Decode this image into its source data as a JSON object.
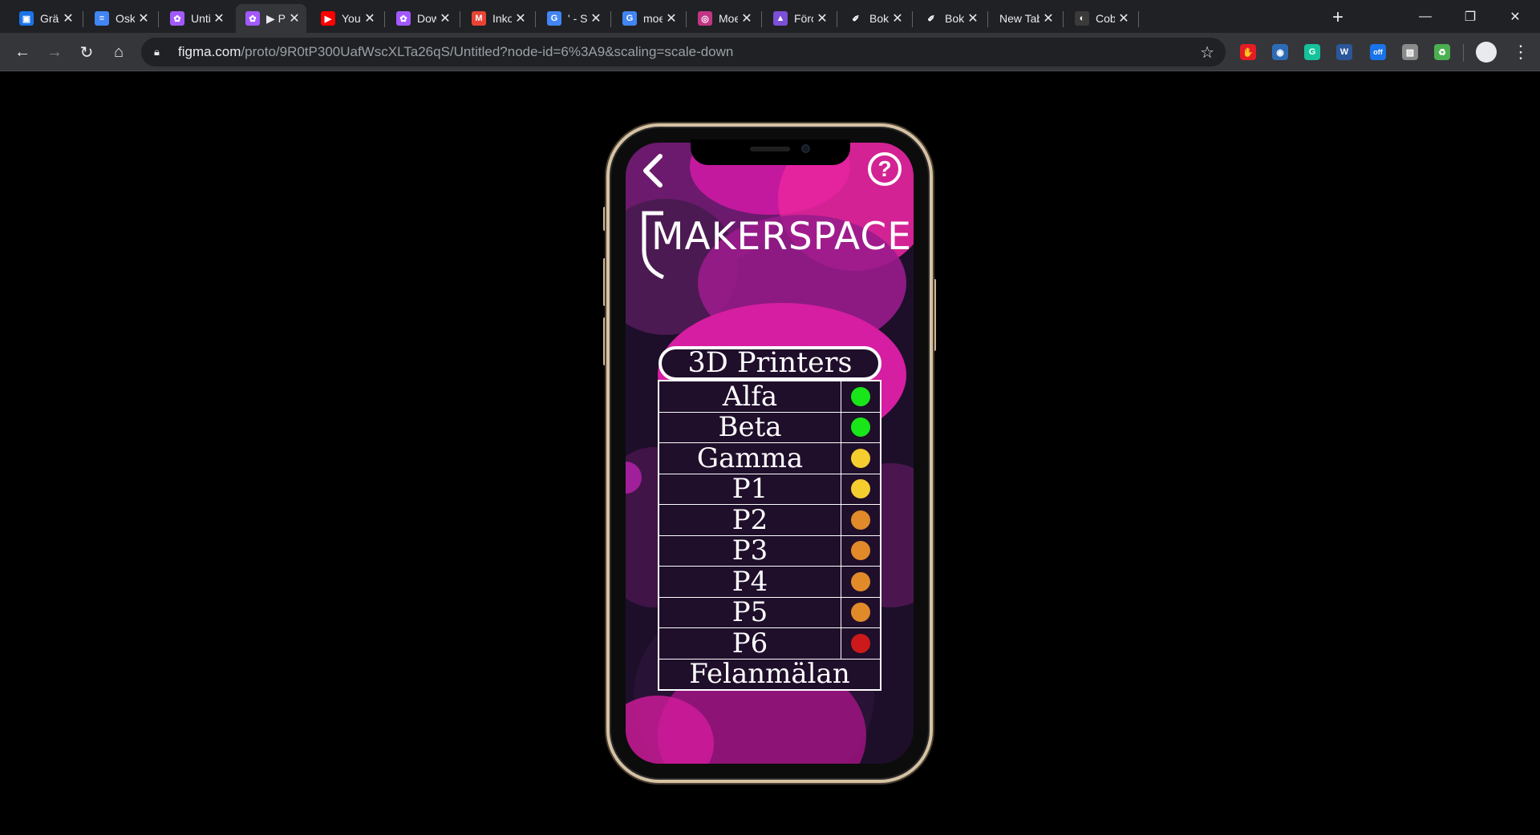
{
  "browser": {
    "tabs": [
      {
        "title": "Grä",
        "fav_color": "#1a73e8",
        "fav_glyph": "▣"
      },
      {
        "title": "Osk",
        "fav_color": "#4285f4",
        "fav_glyph": "≡"
      },
      {
        "title": "Unti",
        "fav_color": "#a259ff",
        "fav_glyph": "✿"
      },
      {
        "title": "▶ Pı",
        "fav_color": "#a259ff",
        "fav_glyph": "✿",
        "active": true
      },
      {
        "title": "YouT",
        "fav_color": "#ff0000",
        "fav_glyph": "▶"
      },
      {
        "title": "Dow",
        "fav_color": "#a259ff",
        "fav_glyph": "✿"
      },
      {
        "title": "Inko",
        "fav_color": "#ea4335",
        "fav_glyph": "M"
      },
      {
        "title": "' - Si",
        "fav_color": "#4285f4",
        "fav_glyph": "G"
      },
      {
        "title": "moe",
        "fav_color": "#4285f4",
        "fav_glyph": "G"
      },
      {
        "title": "Moe",
        "fav_color": "#c13584",
        "fav_glyph": "◎"
      },
      {
        "title": "Förc",
        "fav_color": "#7b4fd6",
        "fav_glyph": "▲"
      },
      {
        "title": "Bok",
        "fav_color": "#202124",
        "fav_glyph": "✐"
      },
      {
        "title": "Bok",
        "fav_color": "#202124",
        "fav_glyph": "✐"
      },
      {
        "title": "New Tab",
        "fav_color": "",
        "fav_glyph": ""
      },
      {
        "title": "Cob",
        "fav_color": "#3a3a3a",
        "fav_glyph": "◐"
      }
    ],
    "url_host": "figma.com",
    "url_path": "/proto/9R0tP300UafWscXLTa26qS/Untitled?node-id=6%3A9&scaling=scale-down",
    "new_tab_symbol": "+",
    "extensions": [
      {
        "name": "adblock-icon",
        "color": "#e51c23",
        "glyph": "✋"
      },
      {
        "name": "owl-icon",
        "color": "#2d6bb5",
        "glyph": "◉"
      },
      {
        "name": "grammarly-icon",
        "color": "#15c39a",
        "glyph": "G"
      },
      {
        "name": "word-icon",
        "color": "#2b579a",
        "glyph": "W"
      },
      {
        "name": "off-badge-icon",
        "color": "#1a73e8",
        "glyph": "off"
      },
      {
        "name": "image-ext-icon",
        "color": "#8a8a8a",
        "glyph": "▨"
      },
      {
        "name": "recycle-ext-icon",
        "color": "#4caf50",
        "glyph": "♻"
      }
    ]
  },
  "app": {
    "logo": "MAKERSPACE",
    "help_symbol": "?",
    "section_title": "3D Printers",
    "printers": [
      {
        "name": "Alfa",
        "status_color": "#19e619"
      },
      {
        "name": "Beta",
        "status_color": "#19e619"
      },
      {
        "name": "Gamma",
        "status_color": "#f5cd2e"
      },
      {
        "name": "P1",
        "status_color": "#f5cd2e"
      },
      {
        "name": "P2",
        "status_color": "#e08a2a"
      },
      {
        "name": "P3",
        "status_color": "#e08a2a"
      },
      {
        "name": "P4",
        "status_color": "#e08a2a"
      },
      {
        "name": "P5",
        "status_color": "#e08a2a"
      },
      {
        "name": "P6",
        "status_color": "#cc1a1a"
      }
    ],
    "report_label": "Felanmälan"
  }
}
